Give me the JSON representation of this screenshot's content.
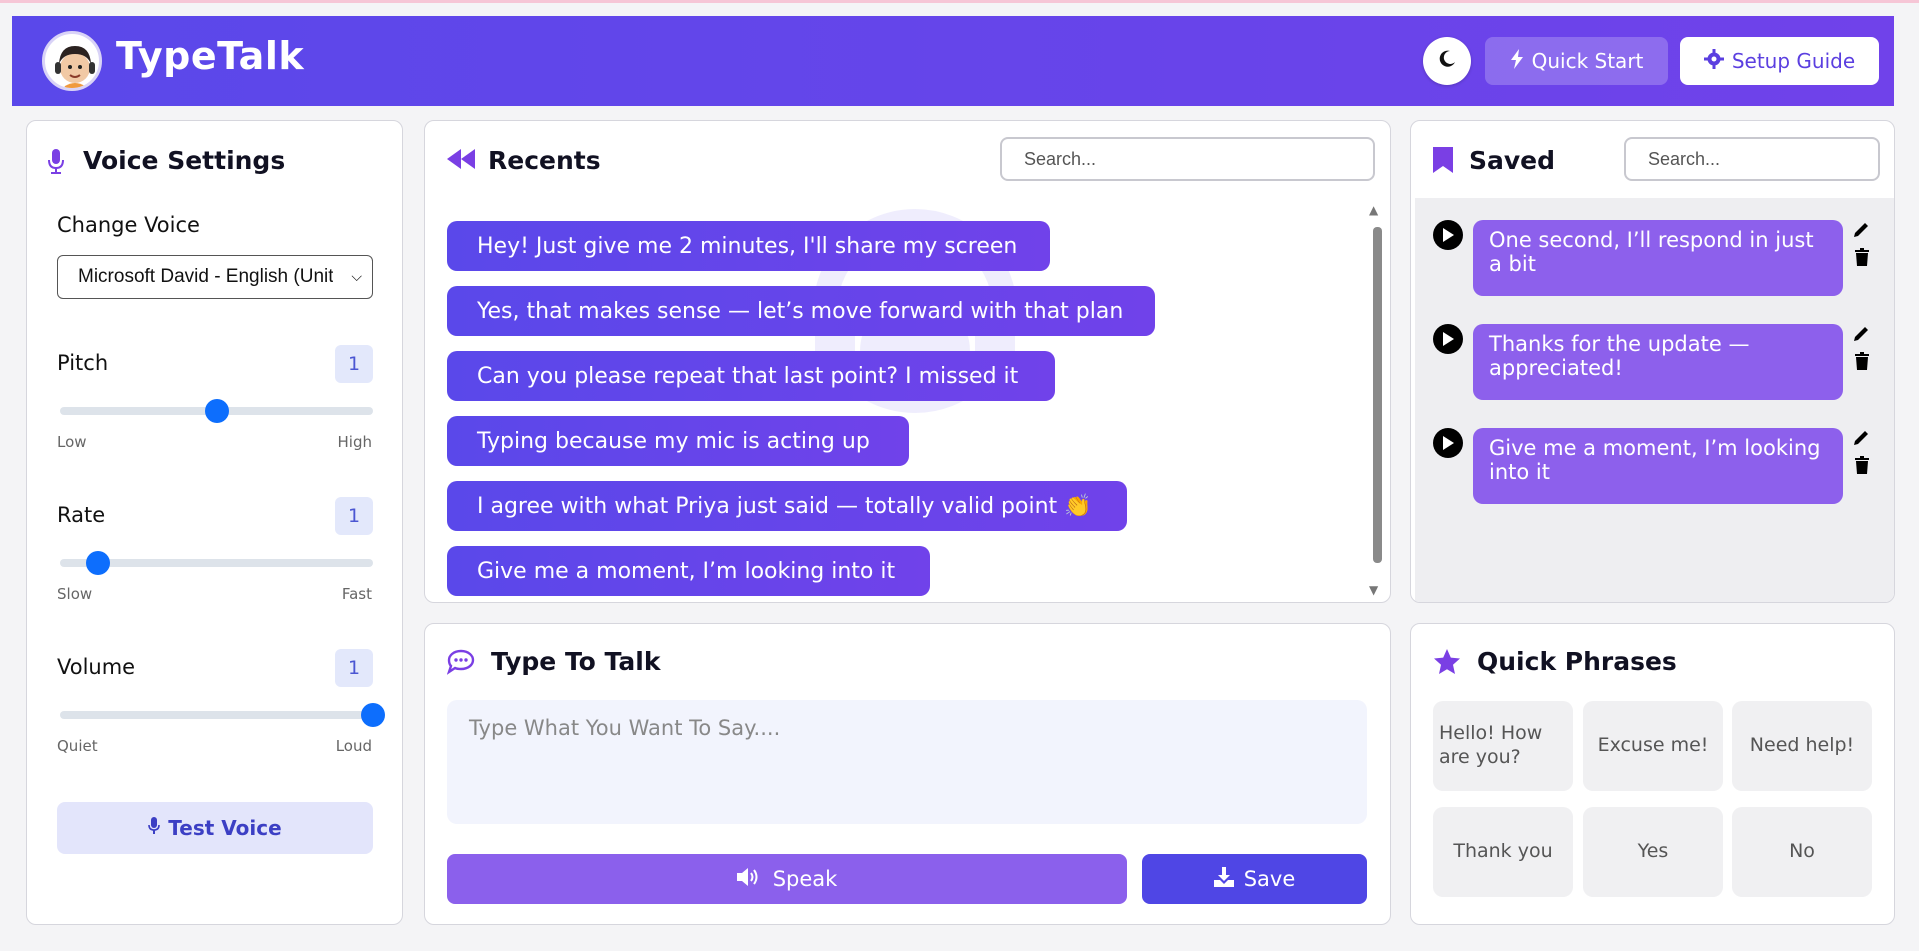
{
  "header": {
    "brand": "TypeTalk",
    "quick_start": "Quick Start",
    "setup_guide": "Setup Guide"
  },
  "voice_settings": {
    "title": "Voice Settings",
    "change_voice_label": "Change Voice",
    "selected_voice": "Microsoft David - English (United States)",
    "pitch": {
      "label": "Pitch",
      "value": "1",
      "min_label": "Low",
      "max_label": "High",
      "fraction": 0.5
    },
    "rate": {
      "label": "Rate",
      "value": "1",
      "min_label": "Slow",
      "max_label": "Fast",
      "fraction": 0.12
    },
    "volume": {
      "label": "Volume",
      "value": "1",
      "min_label": "Quiet",
      "max_label": "Loud",
      "fraction": 1.0
    },
    "test_voice": "Test Voice"
  },
  "recents": {
    "title": "Recents",
    "search_placeholder": "Search...",
    "items": [
      "Hey! Just give me 2 minutes, I'll share my screen",
      "Yes, that makes sense — let’s move forward with that plan",
      "Can you please repeat that last point? I missed it",
      "Typing because my mic is acting up",
      "I agree with what Priya just said — totally valid point 👏",
      "Give me a moment, I’m looking into it"
    ]
  },
  "saved": {
    "title": "Saved",
    "search_placeholder": "Search...",
    "items": [
      "One second, I’ll respond in just a bit",
      "Thanks for the update — appreciated!",
      "Give me a moment, I’m looking into it"
    ]
  },
  "type_to_talk": {
    "title": "Type To Talk",
    "placeholder": "Type What You Want To Say....",
    "speak": "Speak",
    "save": "Save"
  },
  "quick_phrases": {
    "title": "Quick Phrases",
    "items": [
      "Hello! How are you?",
      "Excuse me!",
      "Need help!",
      "Thank you",
      "Yes",
      "No"
    ]
  },
  "colors": {
    "accent": "#5a48ea",
    "accent2": "#7042ea",
    "bubble_saved": "#8d60ec",
    "slider": "#0d6efd"
  }
}
